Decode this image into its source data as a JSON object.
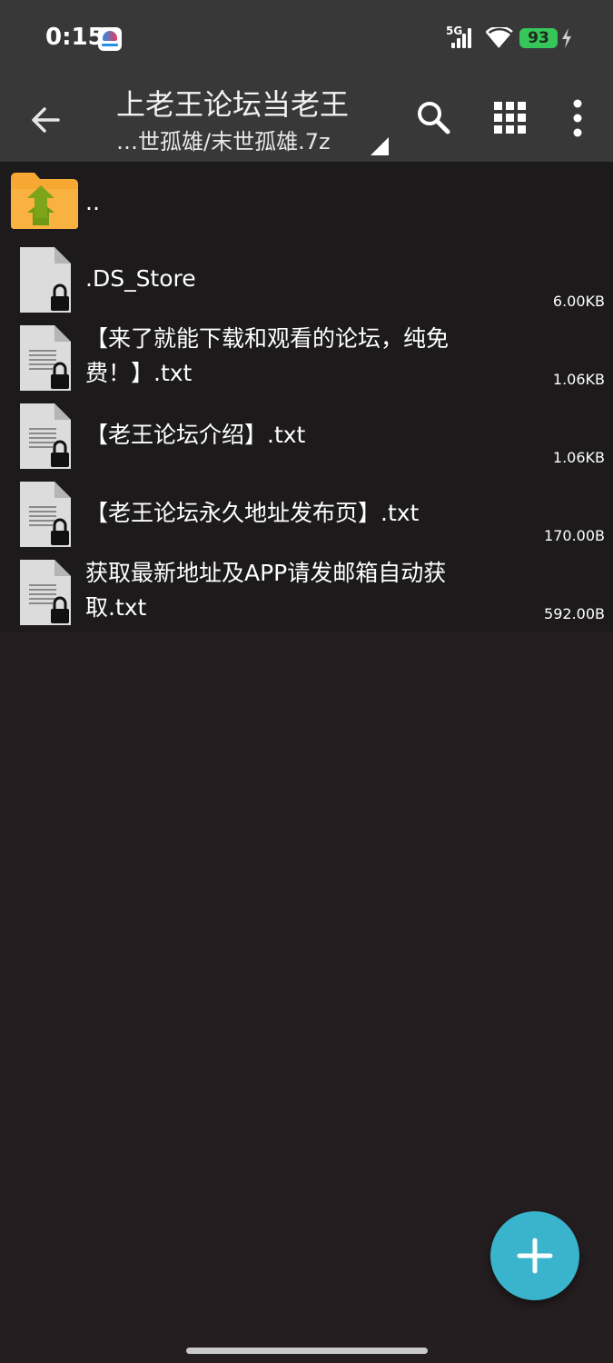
{
  "status_bar": {
    "time": "0:15",
    "network": "5G",
    "battery": "93"
  },
  "toolbar": {
    "title": "上老王论坛当老王",
    "subtitle": "…世孤雄/末世孤雄.7z"
  },
  "files": [
    {
      "name": "..",
      "size": "",
      "type": "parent-folder"
    },
    {
      "name": ".DS_Store",
      "size": "6.00KB",
      "type": "file"
    },
    {
      "name": "【来了就能下载和观看的论坛，纯免费！】.txt",
      "size": "1.06KB",
      "type": "text"
    },
    {
      "name": "【老王论坛介绍】.txt",
      "size": "1.06KB",
      "type": "text"
    },
    {
      "name": "【老王论坛永久地址发布页】.txt",
      "size": "170.00B",
      "type": "text"
    },
    {
      "name": "获取最新地址及APP请发邮箱自动获取.txt",
      "size": "592.00B",
      "type": "text"
    }
  ],
  "colors": {
    "toolbar": "#383838",
    "background": "#251e21",
    "list": "#1c1a1b",
    "fab": "#3ab3cc",
    "folder": "#f7a832",
    "battery": "#36c65a"
  }
}
